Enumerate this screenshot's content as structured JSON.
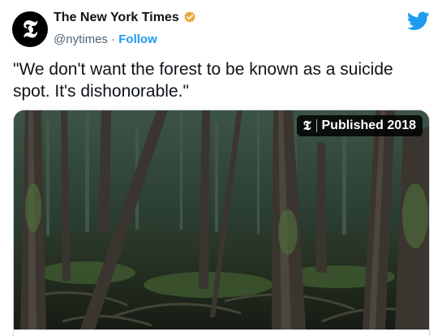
{
  "account": {
    "avatar_glyph": "𝕿",
    "display_name": "The New York Times",
    "handle": "@nytimes",
    "separator": "·",
    "follow_label": "Follow",
    "verified_icon": "verified-badge-icon",
    "verified_color": "#e8a73a"
  },
  "tweet": {
    "text": "\"We don't want the forest to be known as a suicide spot. It's dishonorable.\""
  },
  "media": {
    "badge_logo": "𝕿",
    "badge_text": "Published 2018",
    "image_description_icon": "forest-photo"
  },
  "brand": {
    "twitter_icon": "twitter-bird-icon",
    "accent": "#1d9bf0"
  }
}
